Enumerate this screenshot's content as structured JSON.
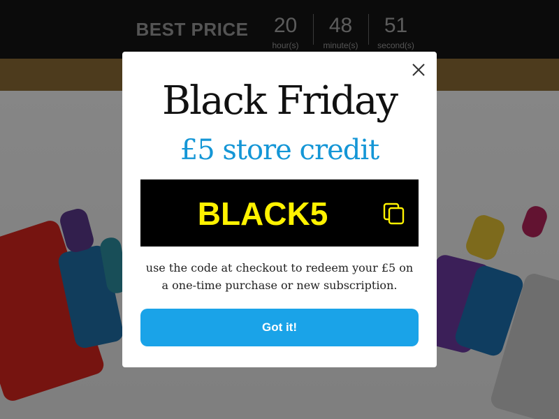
{
  "countdown": {
    "label": "BEST PRICE",
    "hours": "20",
    "hours_label": "hour(s)",
    "minutes": "48",
    "minutes_label": "minute(s)",
    "seconds": "51",
    "seconds_label": "second(s)"
  },
  "modal": {
    "title": "Black Friday",
    "subtitle": "£5 store credit",
    "code": "BLACK5",
    "description": "use the code at checkout to redeem your £5 on a one-time purchase or new subscription.",
    "button_label": "Got it!",
    "close_icon": "close-icon",
    "copy_icon": "copy-icon"
  },
  "colors": {
    "topbar": "#141414",
    "goldbar": "#8c6c36",
    "subtitle": "#1496d6",
    "code_text": "#fff200",
    "code_bg": "#000000",
    "button": "#1aa3e8"
  }
}
